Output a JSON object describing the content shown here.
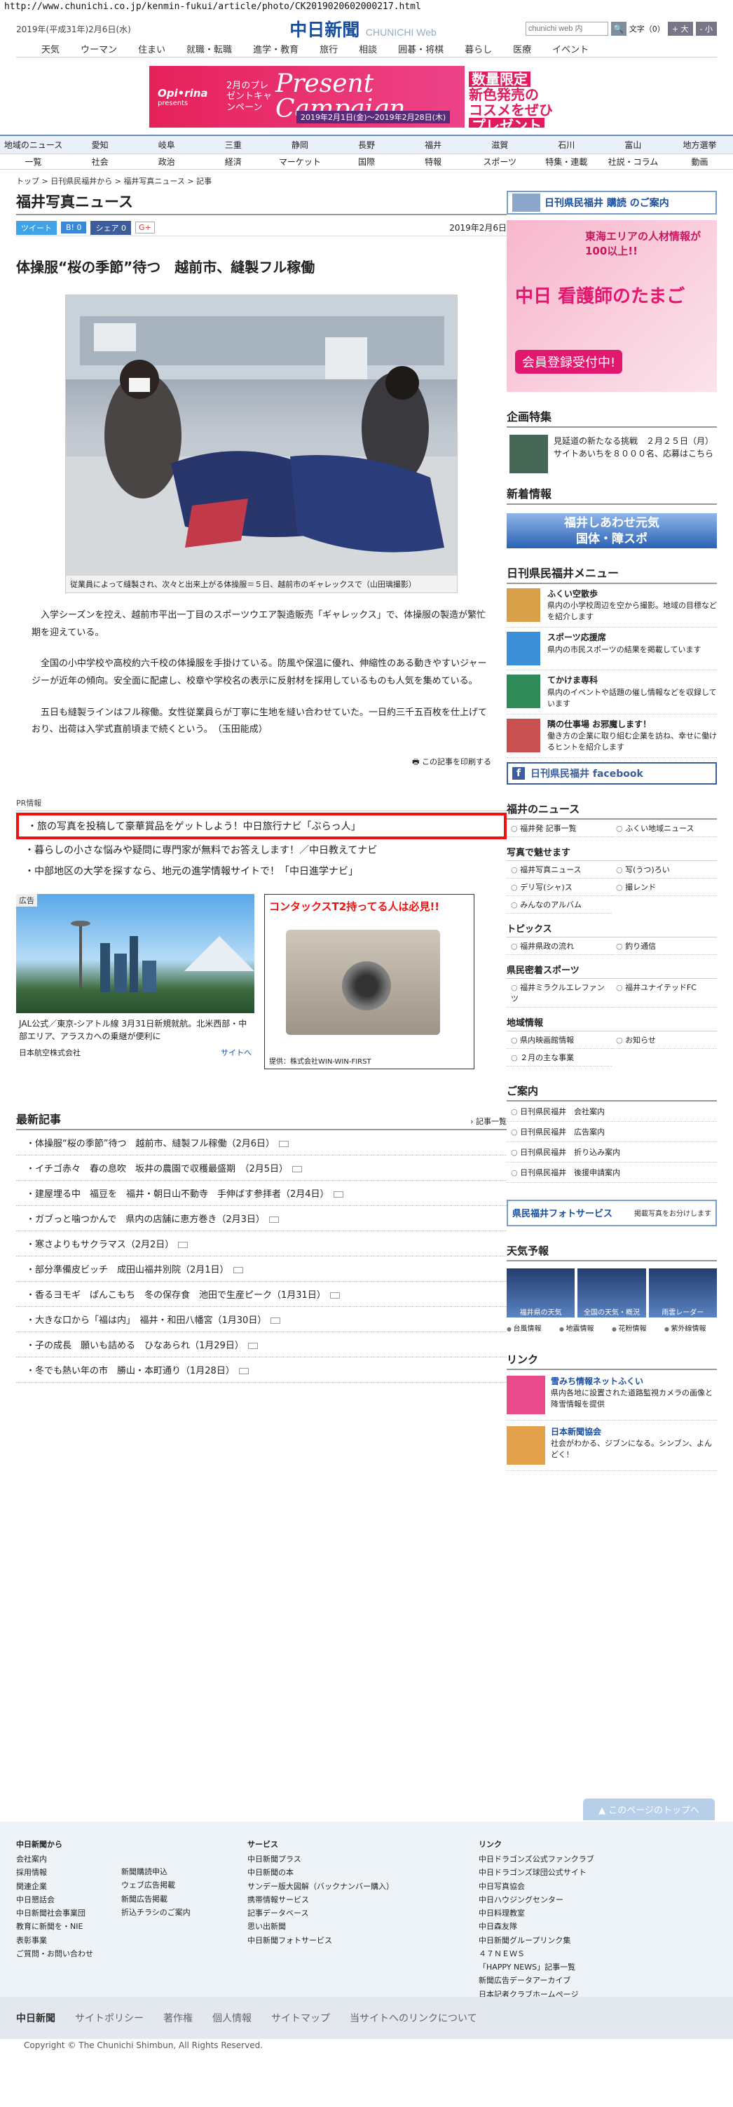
{
  "url": "http://www.chunichi.co.jp/kenmin-fukui/article/photo/CK2019020602000217.html",
  "header": {
    "date": "2019年(平成31年)2月6日(水)",
    "logo": "中日新聞",
    "logo_sub": "CHUNICHI Web",
    "search_placeholder": "chunichi web 内",
    "font_label": "文字（0）",
    "font_up": "+ 大",
    "font_down": "- 小"
  },
  "gnav": [
    "天気",
    "ウーマン",
    "住まい",
    "就職・転職",
    "進学・教育",
    "旅行",
    "相談",
    "囲碁・将棋",
    "暮らし",
    "医療",
    "イベント"
  ],
  "ad_top": {
    "brand": "Opi•rina",
    "presents": "presents",
    "campaign": "2月のプレゼントキャンペーン",
    "title": "Present Campaign",
    "period": "2019年2月1日(金)～2019年2月28日(木)",
    "right1": "数量限定",
    "right2": "新色発売の",
    "right3": "コスメをぜひ",
    "right4": "プレゼント"
  },
  "catnav1": [
    "地域のニュース",
    "愛知",
    "岐阜",
    "三重",
    "静岡",
    "長野",
    "福井",
    "滋賀",
    "石川",
    "富山",
    "地方選挙"
  ],
  "catnav2": [
    "一覧",
    "社会",
    "政治",
    "経済",
    "マーケット",
    "国際",
    "特報",
    "スポーツ",
    "特集・連載",
    "社説・コラム",
    "動画"
  ],
  "breadcrumb": "トップ > 日刊県民福井から > 福井写真ニュース > 記事",
  "section_title": "福井写真ニュース",
  "share": {
    "tweet": "ツイート",
    "hatena": "B! 0",
    "fb": "シェア 0",
    "gplus": "G+",
    "date": "2019年2月6日"
  },
  "article": {
    "headline": "体操服“桜の季節”待つ　越前市、縫製フル稼働",
    "caption": "従業員によって縫製され、次々と出来上がる体操服＝５日、越前市のギャレックスで（山田璃撮影）",
    "paragraphs": [
      "入学シーズンを控え、越前市平出一丁目のスポーツウエア製造販売「ギャレックス」で、体操服の製造が繁忙期を迎えている。",
      "全国の小中学校や高校約六千校の体操服を手掛けている。防風や保温に優れ、伸縮性のある動きやすいジャージーが近年の傾向。安全面に配慮し、校章や学校名の表示に反射材を採用しているものも人気を集めている。",
      "五日も縫製ラインはフル稼働。女性従業員らが丁寧に生地を縫い合わせていた。一日約三千五百枚を仕上げており、出荷は入学式直前頃まで続くという。　（玉田能成）"
    ],
    "print": "この記事を印刷する"
  },
  "pr": {
    "label": "PR情報",
    "items": [
      "旅の写真を投稿して豪華賞品をゲットしよう！中日旅行ナビ「ぶらっ人」",
      "暮らしの小さな悩みや疑問に専門家が無料でお答えします！／中日教えてナビ",
      "中部地区の大学を探すなら、地元の進学情報サイトで！「中日進学ナビ」"
    ]
  },
  "ad_jal": {
    "tag": "広告",
    "text": "JAL公式／東京-シアトル線 3月31日新規就航。北米西部・中部エリア、アラスカへの乗継が便利に",
    "sponsor": "日本航空株式会社",
    "site": "サイトへ"
  },
  "ad_cam": {
    "title": "コンタックスT2持ってる人は必見!!",
    "supplier": "提供：株式会社WIN-WIN-FIRST"
  },
  "latest": {
    "title": "最新記事",
    "more": "記事一覧",
    "items": [
      "体操服“桜の季節”待つ　越前市、縫製フル稼働（2月6日）",
      "イチゴ赤々　春の息吹　坂井の農園で収穫最盛期　（2月5日）",
      "建屋埋る中　福豆を　福井・朝日山不動寺　手伸ばす参拝者（2月4日）",
      "ガブっと噛つかんで　県内の店舗に恵方巻き（2月3日）",
      "寒さよりもサクラマス（2月2日）",
      "部分準備皮ビッチ　成田山福井別院（2月1日）",
      "香るヨモギ　ぱんこもち　冬の保存食　池田で生産ピーク（1月31日）",
      "大きな口から「福は内」　福井・和田八幡宮（1月30日）",
      "子の成長　願いも詰める　ひなあられ（1月29日）",
      "冬でも熱い年の市　勝山・本町通り（1月28日）"
    ]
  },
  "side": {
    "subscribe": "日刊県民福井 購読 のご案内",
    "nurse": {
      "a": "東海エリアの人材情報が100以上!!",
      "b": "中日 看護師のたまご",
      "c": "会員登録受付中!"
    },
    "kikaku_title": "企画特集",
    "kikaku_text": "見延道の新たなる挑戦　２月２５日（月）サイトあいちを８０００名、応募はこちら",
    "new_title": "新着情報",
    "new_banner1": "福井しあわせ元気",
    "new_banner2": "国体・障スポ",
    "menu_title": "日刊県民福井メニュー",
    "menu": [
      {
        "t": "ふくい空散歩",
        "d": "県内の小学校周辺を空から撮影。地域の目標などを紹介します"
      },
      {
        "t": "スポーツ応援席",
        "d": "県内の市民スポーツの結果を掲載しています"
      },
      {
        "t": "てかけま専科",
        "d": "県内のイベントや話題の催し情報などを収録しています"
      },
      {
        "t": "隣の仕事場 お邪魔します！",
        "d": "働き方の企業に取り組む企業を訪ね、幸せに働けるヒントを紹介します"
      }
    ],
    "fb": "日刊県民福井 facebook",
    "news_title": "福井のニュース",
    "news_links": [
      "福井発 記事一覧",
      "ふくい地域ニュース"
    ],
    "photo_sub": "写真で魅せます",
    "photo_links": [
      "福井写真ニュース",
      "写(うつ)ろい",
      "デリ写(シャ)ス",
      "撮レンド",
      "みんなのアルバム"
    ],
    "topics_sub": "トピックス",
    "topics_links": [
      "福井県政の流れ",
      "釣り通信"
    ],
    "sports_sub": "県民密着スポーツ",
    "sports_links": [
      "福井ミラクルエレファンツ",
      "福井ユナイテッドFC"
    ],
    "chiiki_sub": "地域情報",
    "chiiki_links": [
      "県内映画館情報",
      "お知らせ",
      "２月の主な事業"
    ],
    "annai_title": "ご案内",
    "annai_links": [
      "日刊県民福井　会社案内",
      "日刊県民福井　広告案内",
      "日刊県民福井　折り込み案内",
      "日刊県民福井　後援申請案内"
    ],
    "photoserv": "県民福井フォトサービス",
    "photoserv_note": "掲載写真をお分けします",
    "weather_title": "天気予報",
    "weather_tiles": [
      "福井県の天気",
      "全国の天気・概況",
      "雨雲レーダー"
    ],
    "weather_links": [
      "台風情報",
      "地震情報",
      "花粉情報",
      "紫外線情報"
    ],
    "link_title": "リンク",
    "links": [
      {
        "t": "雪みち情報ネットふくい",
        "d": "県内各地に設置された道路監視カメラの画像と降雪情報を提供"
      },
      {
        "t": "日本新聞協会",
        "d": "社会がわかる、ジブンになる。シンブン、よんどく！"
      }
    ]
  },
  "pagetop": "このページのトップへ",
  "footer": {
    "c1_title": "中日新聞から",
    "c1a": [
      "会社案内",
      "採用情報",
      "関連企業",
      "中日懇話会",
      "中日新聞社会事業団",
      "教育に新聞を・NIE",
      "表彰事業",
      "ご質問・お問い合わせ"
    ],
    "c1b": [
      "新聞購読申込",
      "ウェブ広告掲載",
      "新聞広告掲載",
      "折込チラシのご案内"
    ],
    "c2_title": "サービス",
    "c2": [
      "中日新聞プラス",
      "中日新聞の本",
      "サンデー版大図解（バックナンバー購入）",
      "携帯情報サービス",
      "記事データベース",
      "思い出新聞",
      "中日新聞フォトサービス"
    ],
    "c3_title": "リンク",
    "c3": [
      "中日ドラゴンズ公式ファンクラブ",
      "中日ドラゴンズ球団公式サイト",
      "中日写真協会",
      "中日ハウジングセンター",
      "中日料理教室",
      "中日森友隊",
      "中日新聞グループリンク集",
      "４７ＮＥＷＳ",
      "「HAPPY NEWS」記事一覧",
      "新聞広告データアーカイブ",
      "日本記者クラブホームページ"
    ]
  },
  "footbar": [
    "中日新聞",
    "サイトポリシー",
    "著作権",
    "個人情報",
    "サイトマップ",
    "当サイトへのリンクについて"
  ],
  "copyright": "Copyright © The Chunichi Shimbun, All Rights Reserved."
}
